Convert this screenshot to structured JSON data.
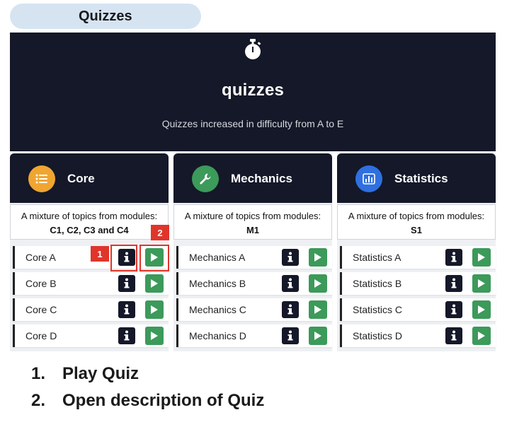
{
  "page_tab": {
    "label": "Quizzes"
  },
  "hero": {
    "icon": "stopwatch-icon",
    "title": "quizzes",
    "subtitle": "Quizzes increased in difficulty from A to E"
  },
  "columns": [
    {
      "title": "Core",
      "icon": "list-icon",
      "icon_color": "#f0a531",
      "desc_line1": "A mixture of topics from modules:",
      "desc_line2": "C1, C2, C3 and C4",
      "quizzes": [
        "Core A",
        "Core B",
        "Core C",
        "Core D"
      ]
    },
    {
      "title": "Mechanics",
      "icon": "wrench-icon",
      "icon_color": "#3c9a5a",
      "desc_line1": "A mixture of topics from modules:",
      "desc_line2": "M1",
      "quizzes": [
        "Mechanics A",
        "Mechanics B",
        "Mechanics C",
        "Mechanics D"
      ]
    },
    {
      "title": "Statistics",
      "icon": "bar-chart-icon",
      "icon_color": "#2f6fe0",
      "desc_line1": "A mixture of topics from modules:",
      "desc_line2": "S1",
      "quizzes": [
        "Statistics A",
        "Statistics B",
        "Statistics C",
        "Statistics D"
      ]
    }
  ],
  "callouts": [
    {
      "number": "1",
      "target": "info-button"
    },
    {
      "number": "2",
      "target": "play-button"
    }
  ],
  "legend": [
    {
      "number": "1.",
      "text": "Play Quiz"
    },
    {
      "number": "2.",
      "text": "Open description of Quiz"
    }
  ],
  "colors": {
    "dark_navy": "#141828",
    "play_green": "#3c9a5a",
    "callout_red": "#e0352b",
    "tab_blue": "#d6e4f2"
  }
}
